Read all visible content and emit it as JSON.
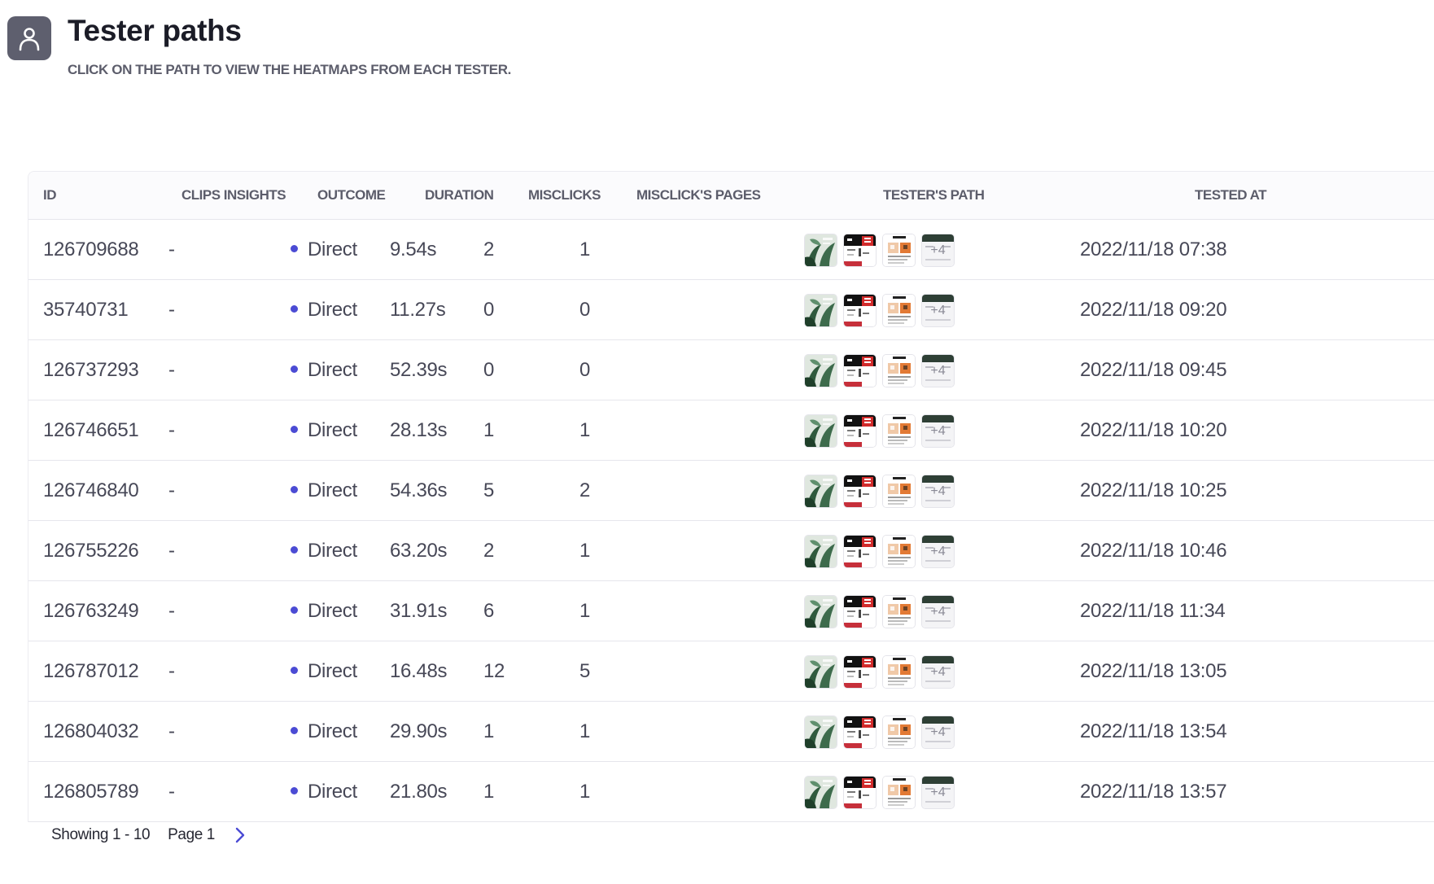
{
  "header": {
    "title": "Tester paths",
    "subtitle": "CLICK ON THE PATH TO VIEW THE HEATMAPS FROM EACH TESTER.",
    "icon": "user-icon"
  },
  "table": {
    "columns": {
      "id": "ID",
      "clips": "CLIPS INSIGHTS",
      "outcome": "OUTCOME",
      "duration": "DURATION",
      "misclicks": "MISCLICKS",
      "misclick_pages": "MISCLICK'S PAGES",
      "path": "TESTER'S PATH",
      "tested_at": "TESTED AT"
    },
    "rows": [
      {
        "id": "126709688",
        "clips": "-",
        "outcome": "Direct",
        "duration": "9.54s",
        "misclicks": "2",
        "misclick_pages": "1",
        "more": "+4",
        "tested_at": "2022/11/18 07:38"
      },
      {
        "id": "35740731",
        "clips": "-",
        "outcome": "Direct",
        "duration": "11.27s",
        "misclicks": "0",
        "misclick_pages": "0",
        "more": "+4",
        "tested_at": "2022/11/18 09:20"
      },
      {
        "id": "126737293",
        "clips": "-",
        "outcome": "Direct",
        "duration": "52.39s",
        "misclicks": "0",
        "misclick_pages": "0",
        "more": "+4",
        "tested_at": "2022/11/18 09:45"
      },
      {
        "id": "126746651",
        "clips": "-",
        "outcome": "Direct",
        "duration": "28.13s",
        "misclicks": "1",
        "misclick_pages": "1",
        "more": "+4",
        "tested_at": "2022/11/18 10:20"
      },
      {
        "id": "126746840",
        "clips": "-",
        "outcome": "Direct",
        "duration": "54.36s",
        "misclicks": "5",
        "misclick_pages": "2",
        "more": "+4",
        "tested_at": "2022/11/18 10:25"
      },
      {
        "id": "126755226",
        "clips": "-",
        "outcome": "Direct",
        "duration": "63.20s",
        "misclicks": "2",
        "misclick_pages": "1",
        "more": "+4",
        "tested_at": "2022/11/18 10:46"
      },
      {
        "id": "126763249",
        "clips": "-",
        "outcome": "Direct",
        "duration": "31.91s",
        "misclicks": "6",
        "misclick_pages": "1",
        "more": "+4",
        "tested_at": "2022/11/18 11:34"
      },
      {
        "id": "126787012",
        "clips": "-",
        "outcome": "Direct",
        "duration": "16.48s",
        "misclicks": "12",
        "misclick_pages": "5",
        "more": "+4",
        "tested_at": "2022/11/18 13:05"
      },
      {
        "id": "126804032",
        "clips": "-",
        "outcome": "Direct",
        "duration": "29.90s",
        "misclicks": "1",
        "misclick_pages": "1",
        "more": "+4",
        "tested_at": "2022/11/18 13:54"
      },
      {
        "id": "126805789",
        "clips": "-",
        "outcome": "Direct",
        "duration": "21.80s",
        "misclicks": "1",
        "misclick_pages": "1",
        "more": "+4",
        "tested_at": "2022/11/18 13:57"
      }
    ]
  },
  "pagination": {
    "showing": "Showing 1 - 10",
    "page": "Page 1",
    "next_icon": "chevron-right-icon"
  },
  "colors": {
    "outcome_dot": "#4b4bd4",
    "accent": "#4b4bd4",
    "avatar_bg": "#5e5f6e"
  }
}
